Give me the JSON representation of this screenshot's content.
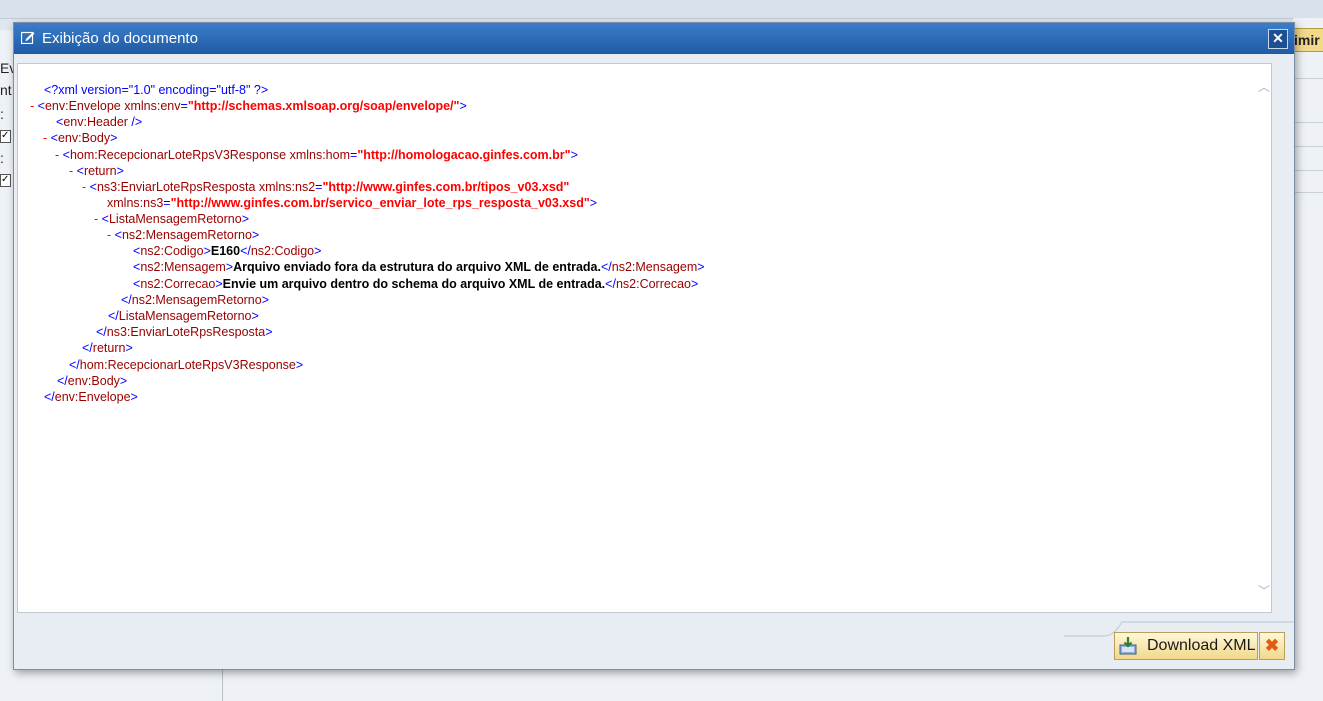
{
  "background": {
    "left_fragments": [
      "Ev",
      "nt",
      ":",
      ":"
    ],
    "right_button_fragment": "imir"
  },
  "dialog": {
    "title": "Exibição do documento",
    "close_symbol": "✕",
    "download_label": "Download XML",
    "cancel_symbol": "✖"
  },
  "xml": {
    "decl": "<?xml version=\"1.0\" encoding=\"utf-8\" ?>",
    "env_envelope": "env:Envelope",
    "xmlns_env_name": "xmlns:env",
    "xmlns_env_value": "\"http://schemas.xmlsoap.org/soap/envelope/\"",
    "env_header": "env:Header",
    "env_body": "env:Body",
    "hom_response": "hom:RecepcionarLoteRpsV3Response",
    "xmlns_hom_name": "xmlns:hom",
    "xmlns_hom_value": "\"http://homologacao.ginfes.com.br\"",
    "return": "return",
    "ns3_resposta": "ns3:EnviarLoteRpsResposta",
    "xmlns_ns2_name": "xmlns:ns2",
    "xmlns_ns2_value": "\"http://www.ginfes.com.br/tipos_v03.xsd\"",
    "xmlns_ns3_name": "xmlns:ns3",
    "xmlns_ns3_value": "\"http://www.ginfes.com.br/servico_enviar_lote_rps_resposta_v03.xsd\"",
    "lista": "ListaMensagemRetorno",
    "mensagem_retorno": "ns2:MensagemRetorno",
    "codigo": "ns2:Codigo",
    "codigo_value": "E160",
    "mensagem": "ns2:Mensagem",
    "mensagem_value": "Arquivo enviado fora da estrutura do arquivo XML de entrada.",
    "correcao": "ns2:Correcao",
    "correcao_value": "Envie um arquivo dentro do schema do arquivo XML de entrada.",
    "minus": "-"
  },
  "colors": {
    "title_bar": "#1f5aa6",
    "tag": "#990000",
    "punct": "#0000ff",
    "attr_value": "#ff0000"
  }
}
